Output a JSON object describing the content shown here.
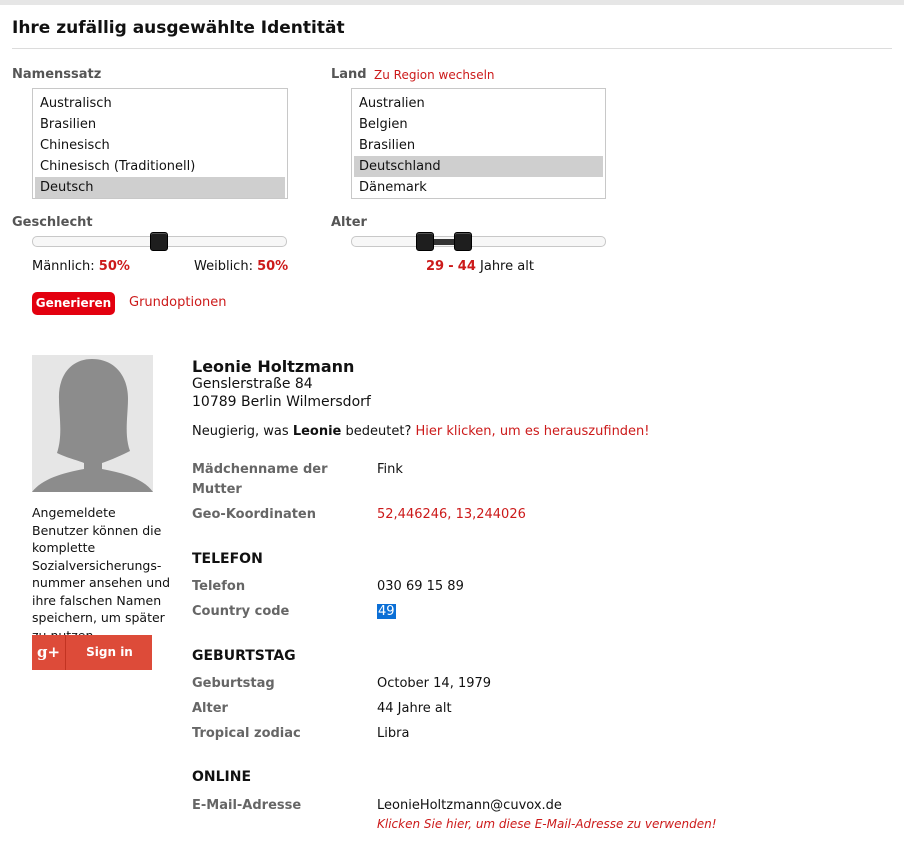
{
  "page": {
    "title": "Ihre zufällig ausgewählte Identität"
  },
  "nameset": {
    "label": "Namenssatz",
    "options": [
      "Australisch",
      "Brasilien",
      "Chinesisch",
      "Chinesisch (Traditionell)",
      "Deutsch"
    ],
    "selected": "Deutsch"
  },
  "country": {
    "label": "Land",
    "region_link": "Zu Region wechseln",
    "options": [
      "Australien",
      "Belgien",
      "Brasilien",
      "Deutschland",
      "Dänemark"
    ],
    "selected": "Deutschland"
  },
  "gender": {
    "label": "Geschlecht",
    "male_label": "Männlich:",
    "male_value": "50%",
    "female_label": "Weiblich:",
    "female_value": "50%",
    "slider_fraction_male": 0.5
  },
  "age": {
    "label": "Alter",
    "min": "29",
    "separator": "-",
    "max": "44",
    "suffix": "Jahre alt"
  },
  "buttons": {
    "generate": "Generieren",
    "basic_options": "Grundoptionen"
  },
  "sidebar": {
    "info": "Angemeldete Benutzer können die komplette Sozialversicherungs-nummer ansehen und ihre falschen Namen speichern, um später zu nutzen.",
    "gplus_icon": "g+",
    "gplus_label": "Sign in"
  },
  "identity": {
    "name": "Leonie Holtzmann",
    "street": "Genslerstraße 84",
    "city": "10789 Berlin Wilmersdorf",
    "curious_prefix": "Neugierig, was ",
    "curious_name": "Leonie",
    "curious_suffix": " bedeutet? ",
    "curious_link": "Hier klicken, um es herauszufinden!"
  },
  "details": {
    "mother_maiden_label": "Mädchenname der Mutter",
    "mother_maiden_value": "Fink",
    "geo_label": "Geo-Koordinaten",
    "geo_value": "52,446246, 13,244026"
  },
  "phone": {
    "heading": "TELEFON",
    "phone_label": "Telefon",
    "phone_value": "030 69 15 89",
    "country_code_label": "Country code",
    "country_code_value": "49"
  },
  "birthday": {
    "heading": "GEBURTSTAG",
    "birthday_label": "Geburtstag",
    "birthday_value": "October 14, 1979",
    "age_label": "Alter",
    "age_value": "44 Jahre alt",
    "zodiac_label": "Tropical zodiac",
    "zodiac_value": "Libra"
  },
  "online": {
    "heading": "ONLINE",
    "email_label": "E-Mail-Adresse",
    "email_value": "LeonieHoltzmann@cuvox.de",
    "email_hint": "Klicken Sie hier, um diese E-Mail-Adresse zu verwenden!"
  },
  "colors": {
    "accent": "#cc1a1a",
    "button": "#e3000f",
    "google": "#dd4b39",
    "selection": "#0b6fd6"
  }
}
